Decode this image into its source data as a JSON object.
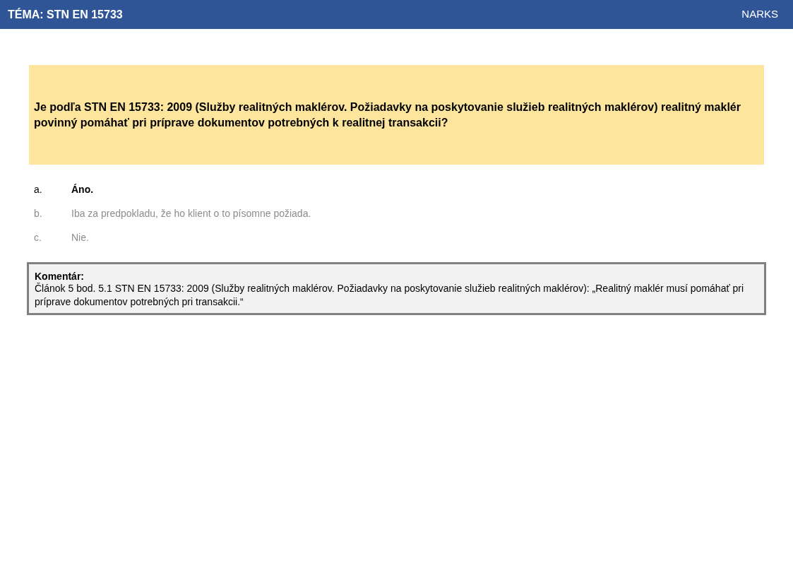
{
  "header": {
    "topic": "TÉMA: STN EN 15733",
    "brand": "NARKS"
  },
  "question": "Je podľa STN EN 15733: 2009 (Služby realitných maklérov. Požiadavky na poskytovanie služieb realitných maklérov) realitný maklér povinný pomáhať pri príprave dokumentov potrebných k realitnej transakcii?",
  "answers": [
    {
      "letter": "a.",
      "text": "Áno.",
      "correct": true
    },
    {
      "letter": "b.",
      "text": "Iba za predpokladu, že ho klient o to písomne požiada.",
      "correct": false
    },
    {
      "letter": "c.",
      "text": "Nie.",
      "correct": false
    }
  ],
  "comment": {
    "title": "Komentár:",
    "text": "Článok 5 bod. 5.1 STN EN 15733: 2009 (Služby realitných maklérov. Požiadavky na poskytovanie služieb realitných maklérov): „Realitný maklér musí pomáhať pri príprave dokumentov potrebných pri transakcii.“"
  }
}
